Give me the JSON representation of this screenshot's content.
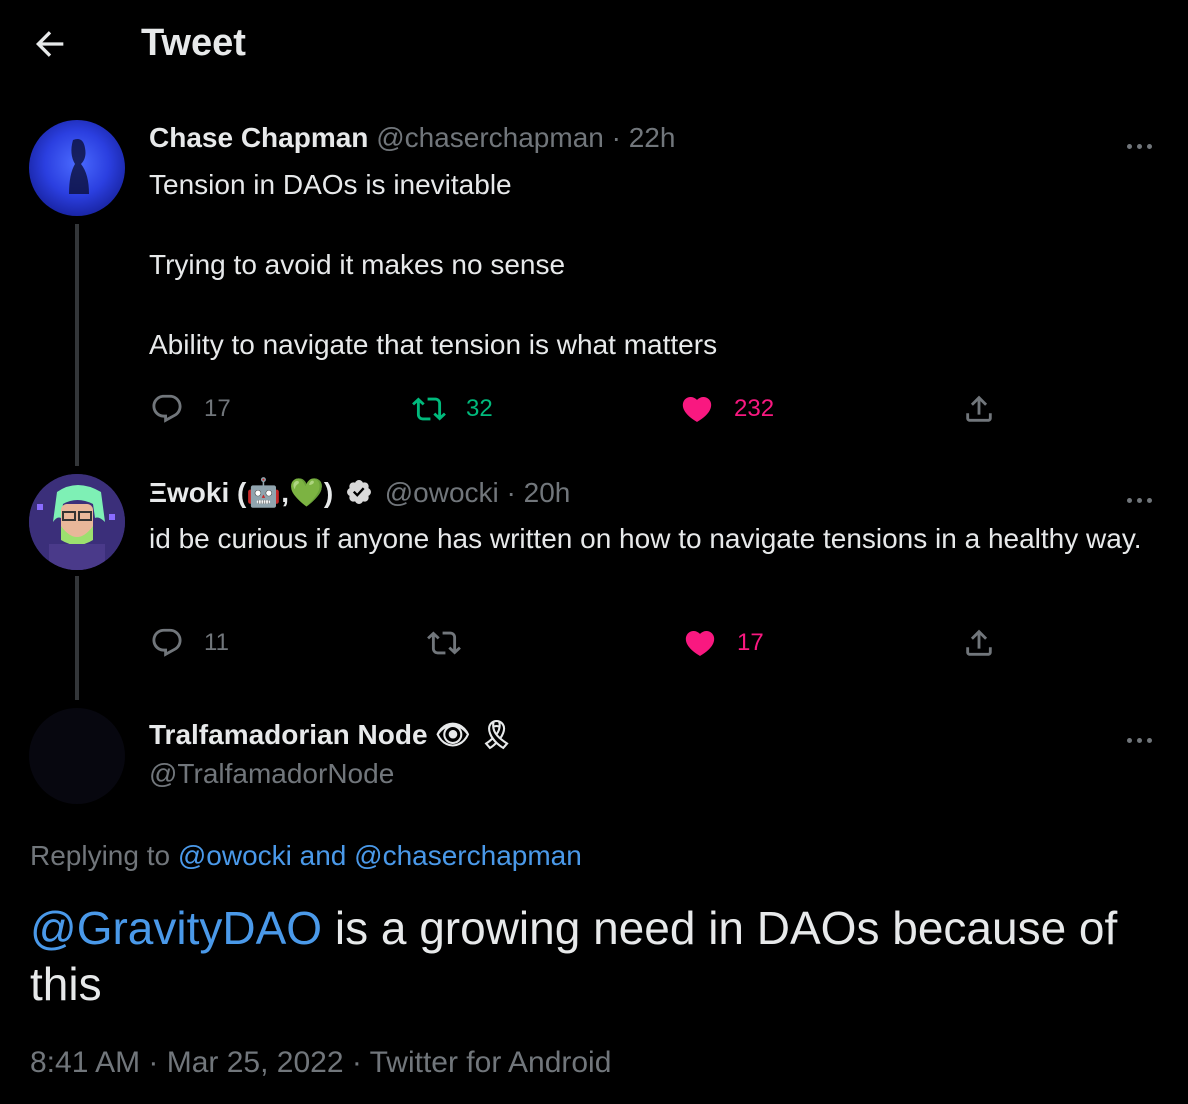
{
  "header": {
    "title": "Tweet"
  },
  "tweets": [
    {
      "name": "Chase Chapman",
      "handle": "@chaserchapman",
      "sep": "·",
      "time": "22h",
      "lines": [
        "Tension in DAOs is inevitable",
        "Trying to avoid it makes no sense",
        "Ability to navigate that tension is what matters"
      ],
      "replies": "17",
      "retweets": "32",
      "likes": "232"
    },
    {
      "name": "Ξwoki (🤖,💚)",
      "handle": "@owocki",
      "sep": "·",
      "time": "20h",
      "lines": [
        "id be curious if anyone has written on how to navigate tensions in a healthy way."
      ],
      "replies": "11",
      "retweets": "",
      "likes": "17"
    }
  ],
  "main_tweet": {
    "name": "Tralfamadorian Node 👁 🎗",
    "handle": "@TralfamadorNode",
    "replying_prefix": "Replying to",
    "replying_users": "@owocki and @chaserchapman",
    "mention": "@GravityDAO",
    "text_rest": " is a growing need in DAOs because of this",
    "timestamp": "8:41 AM · Mar 25, 2022 · Twitter for Android"
  },
  "colors": {
    "retweet": "#00ba7c",
    "like": "#f91880",
    "link": "#1d9bf0"
  },
  "icons": [
    "back-arrow-icon",
    "more-icon",
    "reply-icon",
    "retweet-icon",
    "heart-icon",
    "share-icon",
    "verified-icon"
  ]
}
